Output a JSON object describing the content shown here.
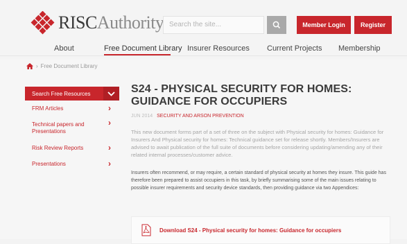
{
  "brand": {
    "name_part1": "RISC",
    "name_part2": "Authority",
    "accent": "#c8262c"
  },
  "header": {
    "search_placeholder": "Search the site...",
    "search_icon": "search-icon",
    "member_login": "Member Login",
    "register": "Register"
  },
  "nav": {
    "items": [
      {
        "label": "About"
      },
      {
        "label": "Free Document Library"
      },
      {
        "label": "Insurer Resources"
      },
      {
        "label": "Current Projects"
      },
      {
        "label": "Membership"
      }
    ],
    "active_index": 1
  },
  "breadcrumb": {
    "home_icon": "home-icon",
    "current": "Free Document Library"
  },
  "sidebar": {
    "header": "Search Free Resources",
    "items": [
      {
        "label": "FRM Articles"
      },
      {
        "label": "Technical papers and",
        "label2": "Presentations"
      },
      {
        "label": "Risk Review Reports"
      },
      {
        "label": "Presentations"
      }
    ]
  },
  "document": {
    "title": "S24 - PHYSICAL SECURITY FOR HOMES: GUIDANCE FOR OCCUPIERS",
    "date": "JUN 2014",
    "category": "SECURITY AND ARSON PREVENTION",
    "intro": "This new document forms part of a set of three on the subject with Physical security for homes: Guidance for Insurers And Physical security for homes: Technical guidance set for release shortly. Members/Insurers are advised to await publication of the full suite of documents before considering updating/amending any of their related internal processes/customer advice.",
    "body": "Insurers often recommend, or may require, a certain standard of physical security at homes they insure. This guide has therefore been prepared to assist occupiers in this task, by briefly summarising some of the main issues relating to possible insurer requirements and security device standards, then providing guidance via two Appendices:",
    "download_label": "Download S24 - Physical security for homes: Guidance for occupiers",
    "download_icon": "pdf-icon"
  }
}
